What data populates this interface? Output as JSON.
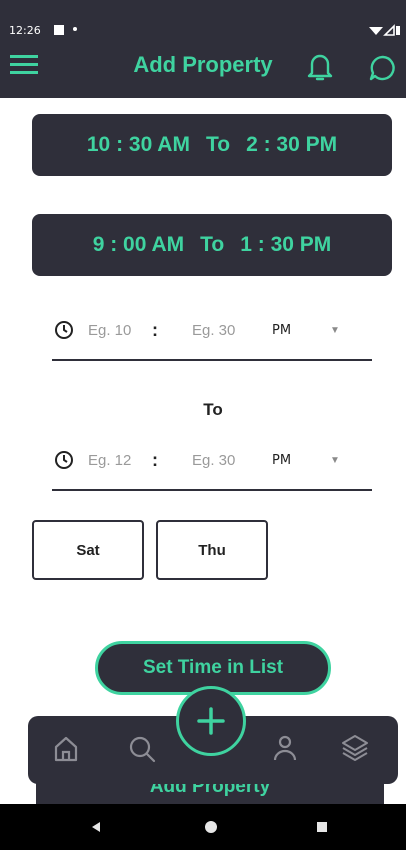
{
  "status_bar": {
    "time": "12:26"
  },
  "app_bar": {
    "title": "Add Property"
  },
  "time_slots": [
    {
      "start": "10 : 30 AM",
      "sep": "To",
      "end": "2 : 30 PM"
    },
    {
      "start": "9 : 00 AM",
      "sep": "To",
      "end": "1 : 30 PM"
    }
  ],
  "from_picker": {
    "hour_placeholder": "Eg. 10",
    "colon": ":",
    "minute_placeholder": "Eg. 30",
    "ampm": "PM"
  },
  "to_label": "To",
  "to_picker": {
    "hour_placeholder": "Eg. 12",
    "colon": ":",
    "minute_placeholder": "Eg. 30",
    "ampm": "PM"
  },
  "days": [
    "Sat",
    "Thu"
  ],
  "set_time_button": "Set Time in List",
  "add_property_button": "Add Property",
  "colors": {
    "dark": "#2f2f3a",
    "accent": "#3fd3a0"
  },
  "icons": [
    "menu-icon",
    "bell-icon",
    "chat-icon",
    "clock-icon",
    "home-icon",
    "search-icon",
    "plus-icon",
    "profile-icon",
    "layers-icon",
    "back-icon",
    "home-circle-icon",
    "recents-icon"
  ]
}
